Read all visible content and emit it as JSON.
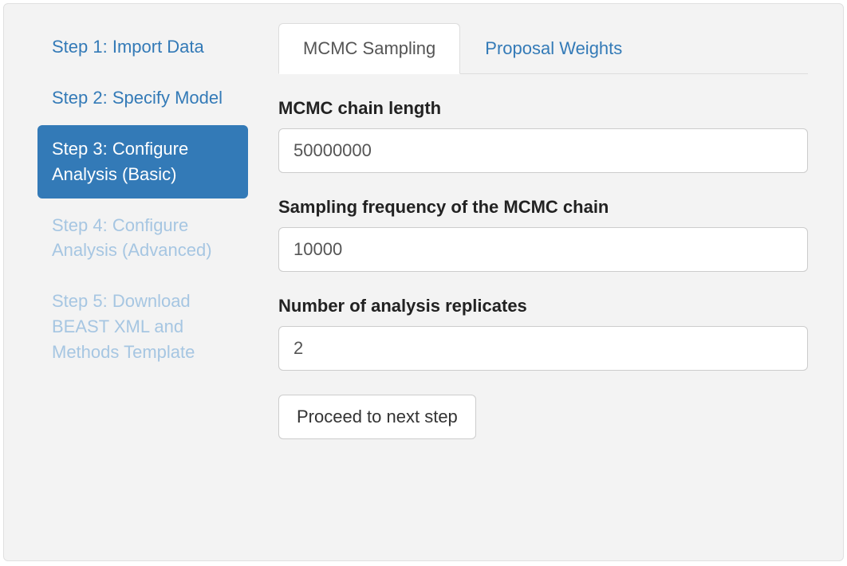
{
  "sidebar": {
    "items": [
      {
        "label": "Step 1: Import Data",
        "state": "normal"
      },
      {
        "label": "Step 2: Specify Model",
        "state": "normal"
      },
      {
        "label": "Step 3: Configure Analysis (Basic)",
        "state": "active"
      },
      {
        "label": "Step 4: Configure Analysis (Advanced)",
        "state": "disabled"
      },
      {
        "label": "Step 5: Download BEAST XML and Methods Template",
        "state": "disabled"
      }
    ]
  },
  "tabs": [
    {
      "label": "MCMC Sampling",
      "active": true
    },
    {
      "label": "Proposal Weights",
      "active": false
    }
  ],
  "form": {
    "chain_length_label": "MCMC chain length",
    "chain_length_value": "50000000",
    "sampling_freq_label": "Sampling frequency of the MCMC chain",
    "sampling_freq_value": "10000",
    "replicates_label": "Number of analysis replicates",
    "replicates_value": "2",
    "proceed_label": "Proceed to next step"
  }
}
